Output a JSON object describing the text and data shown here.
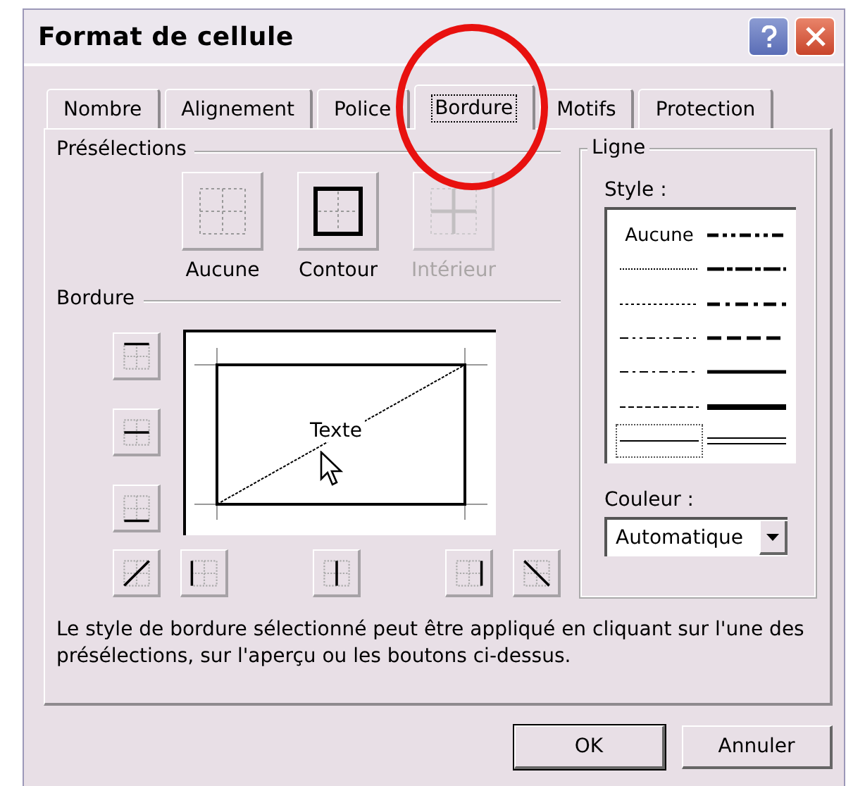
{
  "window": {
    "title": "Format de cellule"
  },
  "tabs": [
    {
      "label": "Nombre",
      "selected": false
    },
    {
      "label": "Alignement",
      "selected": false
    },
    {
      "label": "Police",
      "selected": false
    },
    {
      "label": "Bordure",
      "selected": true
    },
    {
      "label": "Motifs",
      "selected": false
    },
    {
      "label": "Protection",
      "selected": false
    }
  ],
  "presets": {
    "title": "Présélections",
    "items": [
      {
        "kind": "none",
        "label": "Aucune",
        "disabled": false
      },
      {
        "kind": "outline",
        "label": "Contour",
        "disabled": false
      },
      {
        "kind": "inside",
        "label": "Intérieur",
        "disabled": true
      }
    ]
  },
  "border": {
    "title": "Bordure",
    "side_buttons": [
      {
        "kind": "top"
      },
      {
        "kind": "middle-h"
      },
      {
        "kind": "bottom"
      }
    ],
    "bottom_buttons": [
      {
        "kind": "diag-up"
      },
      {
        "kind": "left"
      },
      {
        "kind": "middle-v"
      },
      {
        "kind": "right"
      },
      {
        "kind": "diag-down"
      }
    ],
    "preview_text": "Texte"
  },
  "line": {
    "title": "Ligne",
    "style_label": "Style :",
    "styles": [
      {
        "kind": "none",
        "label": "Aucune",
        "selected": false
      },
      {
        "kind": "hair",
        "selected": false
      },
      {
        "kind": "dotted",
        "selected": false
      },
      {
        "kind": "dash-dot-dot",
        "selected": false
      },
      {
        "kind": "dash-dot",
        "selected": false
      },
      {
        "kind": "dashed",
        "selected": false
      },
      {
        "kind": "thin",
        "selected": true
      },
      {
        "kind": "m-dash-dot-dot",
        "selected": false
      },
      {
        "kind": "slant",
        "selected": false
      },
      {
        "kind": "m-dash-dot",
        "selected": false
      },
      {
        "kind": "m-dashed",
        "selected": false
      },
      {
        "kind": "medium",
        "selected": false
      },
      {
        "kind": "thick",
        "selected": false
      },
      {
        "kind": "double",
        "selected": false
      }
    ],
    "color_label": "Couleur :",
    "color_value": "Automatique"
  },
  "description": "Le style de bordure sélectionné peut être appliqué en cliquant sur l'une des présélections, sur l'aperçu ou les boutons ci-dessus.",
  "buttons": [
    {
      "label": "OK",
      "default": true
    },
    {
      "label": "Annuler",
      "default": false
    }
  ]
}
